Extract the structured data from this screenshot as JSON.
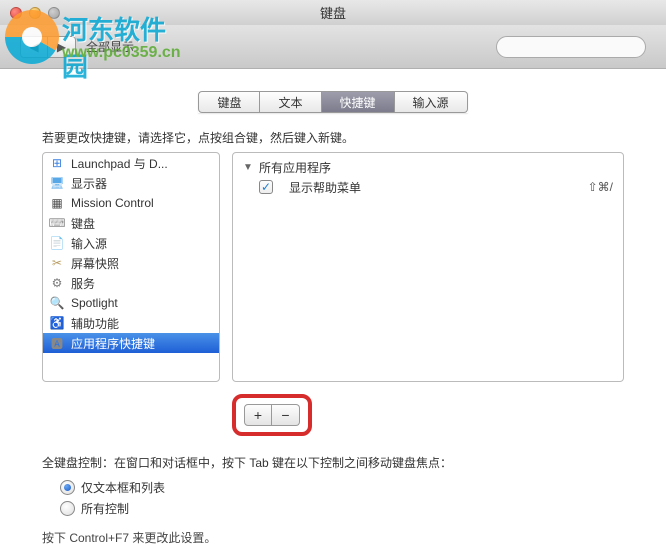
{
  "window": {
    "title": "键盘"
  },
  "toolbar": {
    "show_all": "全部显示",
    "search_placeholder": ""
  },
  "watermark": {
    "brand": "河东软件园",
    "url": "www.pc0359.cn",
    "center": ""
  },
  "tabs": [
    "键盘",
    "文本",
    "快捷键",
    "输入源"
  ],
  "active_tab_index": 2,
  "hint": "若要更改快捷键，请选择它，点按组合键，然后键入新键。",
  "categories": [
    {
      "label": "Launchpad 与 D...",
      "icon": "launchpad",
      "color": "#3d82e0"
    },
    {
      "label": "显示器",
      "icon": "display",
      "color": "#58a8e8"
    },
    {
      "label": "Mission Control",
      "icon": "mission",
      "color": "#4d4d4d"
    },
    {
      "label": "键盘",
      "icon": "keyboard",
      "color": "#999"
    },
    {
      "label": "输入源",
      "icon": "input",
      "color": "#888"
    },
    {
      "label": "屏幕快照",
      "icon": "screenshot",
      "color": "#b89b5e"
    },
    {
      "label": "服务",
      "icon": "services",
      "color": "#7a7a7a"
    },
    {
      "label": "Spotlight",
      "icon": "spotlight",
      "color": "#1a88e8"
    },
    {
      "label": "辅助功能",
      "icon": "accessibility",
      "color": "#1a88e8"
    },
    {
      "label": "应用程序快捷键",
      "icon": "apps",
      "color": "#888"
    }
  ],
  "selected_category_index": 9,
  "shortcuts": {
    "group_label": "所有应用程序",
    "items": [
      {
        "checked": true,
        "label": "显示帮助菜单",
        "keys": "⇧⌘/"
      }
    ]
  },
  "buttons": {
    "add": "+",
    "remove": "−"
  },
  "footer": {
    "text": "全键盘控制：在窗口和对话框中，按下 Tab 键在以下控制之间移动键盘焦点：",
    "radio1": "仅文本框和列表",
    "radio2": "所有控制",
    "hint": "按下 Control+F7 来更改此设置。"
  }
}
